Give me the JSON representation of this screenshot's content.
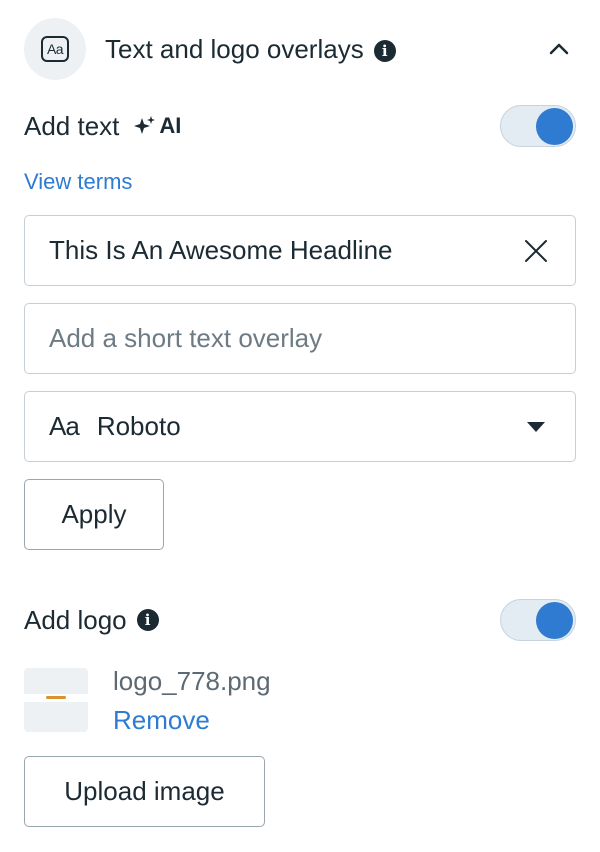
{
  "section": {
    "title": "Text and logo overlays",
    "header_icon": "Aa",
    "info_icon": "i",
    "collapse_icon": "chevron-up-icon"
  },
  "add_text": {
    "label": "Add text",
    "ai_badge": "AI",
    "ai_icon": "sparkle-icon",
    "enabled": true,
    "view_terms": "View terms",
    "headline_value": "This Is An Awesome Headline",
    "overlay_placeholder": "Add a short text overlay",
    "font_prefix": "Aa",
    "font_value": "Roboto",
    "apply_label": "Apply"
  },
  "add_logo": {
    "label": "Add logo",
    "info_icon": "i",
    "enabled": true,
    "file_name": "logo_778.png",
    "remove_label": "Remove",
    "upload_label": "Upload image"
  },
  "colors": {
    "accent": "#2e7bd1",
    "text": "#1c2b33",
    "border": "#c7cfd5"
  }
}
